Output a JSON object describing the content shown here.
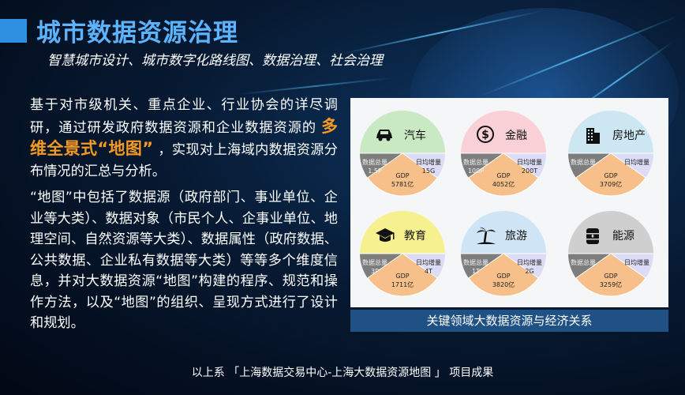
{
  "slide": {
    "title": "城市数据资源治理",
    "subtitle": "智慧城市设计、城市数字化路线图、数据治理、社会治理"
  },
  "body": {
    "p1_before": "基于对市级机关、重点企业、行业协会的详尽调研，通过研发政府数据资源和企业数据资源的",
    "p1_highlight": "多维全景式“地图”",
    "p1_after": "，实现对上海域内数据资源分布情况的汇总与分析。",
    "p2": "“地图”中包括了数据源（政府部门、事业单位、企业等大类）、数据对象（市民个人、企事业单位、地理空间、自然资源等大类）、数据属性（政府数据、公共数据、企业私有数据等大类）等等多个维度信息，并对大数据资源“地图”构建的程序、规范和操作方法，以及“地图”的组织、呈现方式进行了设计和规划。"
  },
  "figure": {
    "caption": "关键领域大数据资源与经济关系",
    "items": [
      {
        "name": "汽车",
        "icon": "car-icon",
        "top_color": "#c8e9c2",
        "seg_left": [
          "数据总量",
          "1.5P"
        ],
        "seg_mid": [
          "GDP",
          "5781亿"
        ],
        "seg_right": [
          "日均增量",
          "15G"
        ]
      },
      {
        "name": "金融",
        "icon": "dollar-icon",
        "top_color": "#f9d0d6",
        "seg_left": [
          "数据总量",
          "100P"
        ],
        "seg_mid": [
          "GDP",
          "4052亿"
        ],
        "seg_right": [
          "日均增量",
          "200T"
        ]
      },
      {
        "name": "房地产",
        "icon": "building-icon",
        "top_color": "#cde7f2",
        "seg_left": [
          "数据总量",
          ""
        ],
        "seg_mid": [
          "GDP",
          "3709亿"
        ],
        "seg_right": [
          "日均增量",
          ""
        ]
      },
      {
        "name": "教育",
        "icon": "graduation-cap-icon",
        "top_color": "#f7f08f",
        "seg_left": [
          "数据总量",
          "3P"
        ],
        "seg_mid": [
          "GDP",
          "1711亿"
        ],
        "seg_right": [
          "日均增量",
          "4T"
        ]
      },
      {
        "name": "旅游",
        "icon": "palm-tree-icon",
        "top_color": "#cfe4f5",
        "seg_left": [
          "数据总量",
          "1T"
        ],
        "seg_mid": [
          "GDP",
          "3820亿"
        ],
        "seg_right": [
          "日均增量",
          "2G"
        ]
      },
      {
        "name": "能源",
        "icon": "oil-barrel-icon",
        "top_color": "#cfcfcf",
        "seg_left": [
          "数据总量",
          ""
        ],
        "seg_mid": [
          "GDP",
          "3259亿"
        ],
        "seg_right": [
          "日均增量",
          ""
        ]
      }
    ]
  },
  "colors": {
    "title": "#5cb3ff",
    "highlight": "#f59a23",
    "seg_left": "#7d7d7d",
    "seg_mid": "#f7c08b",
    "seg_right": "#dcdcf7",
    "caption_bg": "#1f5184"
  },
  "footer": "以上系 「上海数据交易中心-上海大数据资源地图 」 项目成果"
}
